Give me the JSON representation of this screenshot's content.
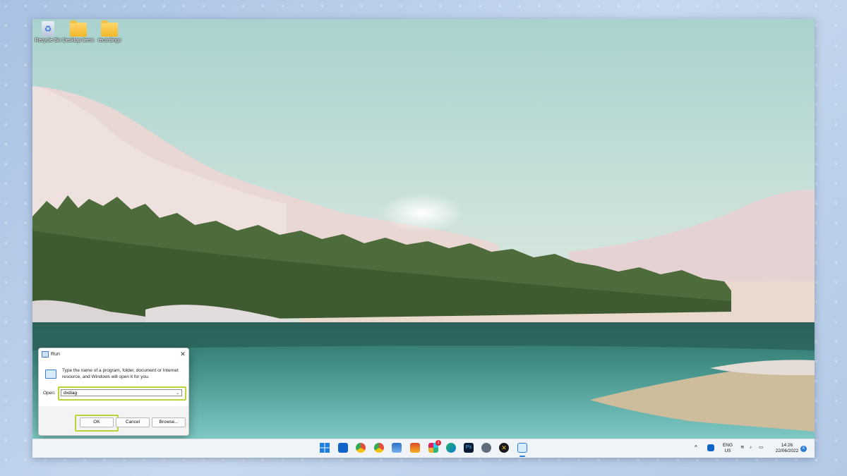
{
  "desktop": {
    "icons": [
      {
        "label": "Recycle Bin",
        "icon": "recycle-bin-icon"
      },
      {
        "label": "Desktop Items",
        "icon": "folder-icon"
      },
      {
        "label": "recordings",
        "icon": "folder-icon"
      }
    ]
  },
  "run_dialog": {
    "title": "Run",
    "description": "Type the name of a program, folder, document or Internet resource, and Windows will open it for you.",
    "open_label": "Open:",
    "open_value": "dxdiag",
    "ok_label": "OK",
    "cancel_label": "Cancel",
    "browse_label": "Browse..."
  },
  "taskbar": {
    "apps": [
      "windows-start-icon",
      "outlook-icon",
      "chrome-icon",
      "chrome-canary-icon",
      "photos-icon",
      "office-icon",
      "slack-icon",
      "edge-icon",
      "photoshop-icon",
      "settings-icon",
      "xbox-icon",
      "run-icon"
    ],
    "slack_badge": "1",
    "language": "ENG",
    "region": "US",
    "time": "14:26",
    "date": "22/06/2022",
    "notification_count": "6"
  },
  "colors": {
    "highlight": "#b7d43a",
    "taskbar_bg": "#f0f3f8"
  }
}
